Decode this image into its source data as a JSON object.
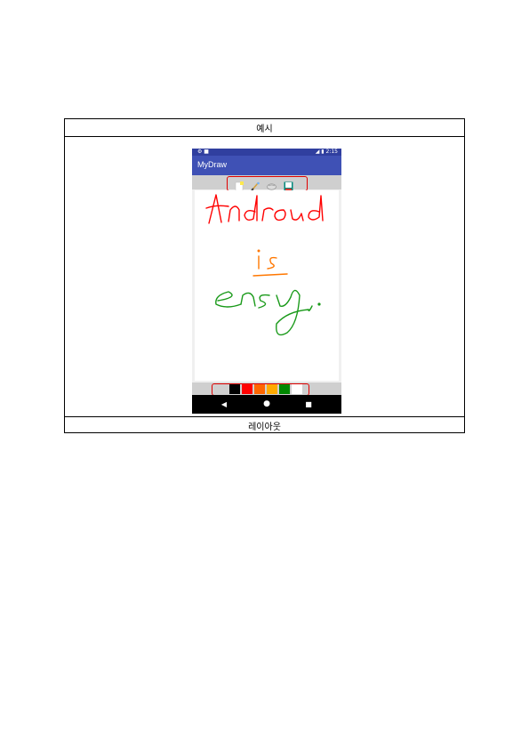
{
  "table": {
    "header": "예시",
    "footer": "레이아웃"
  },
  "phone": {
    "status": {
      "left": "⚙ ■",
      "right": "◢ ▮ 2:15"
    },
    "app_title": "MyDraw",
    "tools": [
      {
        "icon": "new-page-icon",
        "color": "#fff7c0"
      },
      {
        "icon": "brush-icon",
        "color": "#c88a2a"
      },
      {
        "icon": "eraser-icon",
        "color": "#9e9e9e"
      },
      {
        "icon": "save-icon",
        "color": "#00897b"
      }
    ],
    "palette": [
      "#000000",
      "#ff0000",
      "#ff6600",
      "#ffaa00",
      "#008800",
      "#ffffff"
    ],
    "drawing": {
      "line1": "Android",
      "line2": "is",
      "line3": "easy.",
      "colors": {
        "red": "#ff0000",
        "orange": "#ff7700",
        "green": "#1a9a1a"
      }
    },
    "nav": {
      "back": "◀",
      "home": "●",
      "recent": "■"
    }
  }
}
